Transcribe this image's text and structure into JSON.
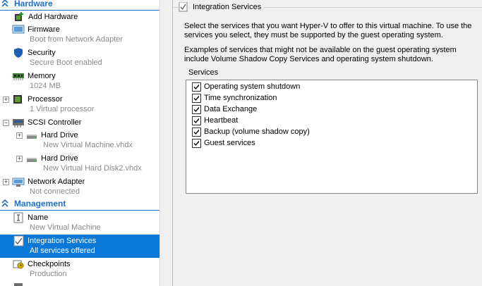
{
  "tree": {
    "sections": {
      "hardware": "Hardware",
      "management": "Management"
    },
    "items": [
      {
        "label": "Add Hardware",
        "sub": ""
      },
      {
        "label": "Firmware",
        "sub": "Boot from Network Adapter"
      },
      {
        "label": "Security",
        "sub": "Secure Boot enabled"
      },
      {
        "label": "Memory",
        "sub": "1024 MB"
      },
      {
        "label": "Processor",
        "sub": "1 Virtual processor"
      },
      {
        "label": "SCSI Controller",
        "sub": ""
      },
      {
        "label": "Hard Drive",
        "sub": "New Virtual Machine.vhdx"
      },
      {
        "label": "Hard Drive",
        "sub": "New Virtual Hard Disk2.vhdx"
      },
      {
        "label": "Network Adapter",
        "sub": "Not connected"
      },
      {
        "label": "Name",
        "sub": "New Virtual Machine"
      },
      {
        "label": "Integration Services",
        "sub": "All services offered"
      },
      {
        "label": "Checkpoints",
        "sub": "Production"
      }
    ]
  },
  "panel": {
    "title": "Integration Services",
    "description": "Select the services that you want Hyper-V to offer to this virtual machine. To use the services you select, they must be supported by the guest operating system.",
    "examples": "Examples of services that might not be available on the guest operating system include Volume Shadow Copy Services and operating system shutdown.",
    "services_label": "Services",
    "services": [
      {
        "label": "Operating system shutdown",
        "checked": true
      },
      {
        "label": "Time synchronization",
        "checked": true
      },
      {
        "label": "Data Exchange",
        "checked": true
      },
      {
        "label": "Heartbeat",
        "checked": true
      },
      {
        "label": "Backup (volume shadow copy)",
        "checked": true
      },
      {
        "label": "Guest services",
        "checked": true
      }
    ]
  },
  "colors": {
    "accent": "#1f6fc5",
    "selected": "#0a78d7"
  }
}
